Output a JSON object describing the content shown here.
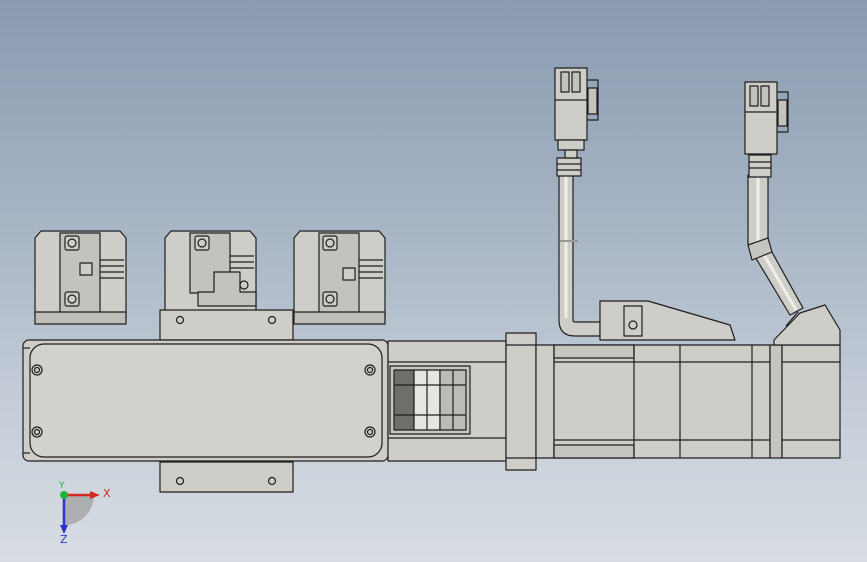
{
  "triad": {
    "x_label": "X",
    "y_label": "Y",
    "z_label": "Z"
  },
  "colors": {
    "part_fill": "#cfcdc7",
    "part_dark": "#b5b3ad",
    "edge": "#1e1e1e",
    "x_axis": "#d42a1e",
    "y_axis": "#1fb53b",
    "z_axis": "#2a36c9"
  },
  "components": [
    "actuator-body",
    "mounting-bracket-top",
    "mounting-bracket-bottom",
    "sensor-switch-1",
    "sensor-switch-2",
    "sensor-switch-3",
    "coupling-housing",
    "motor-flange",
    "servo-motor",
    "encoder-cap",
    "cable-power",
    "cable-encoder",
    "connector-power",
    "connector-encoder"
  ]
}
